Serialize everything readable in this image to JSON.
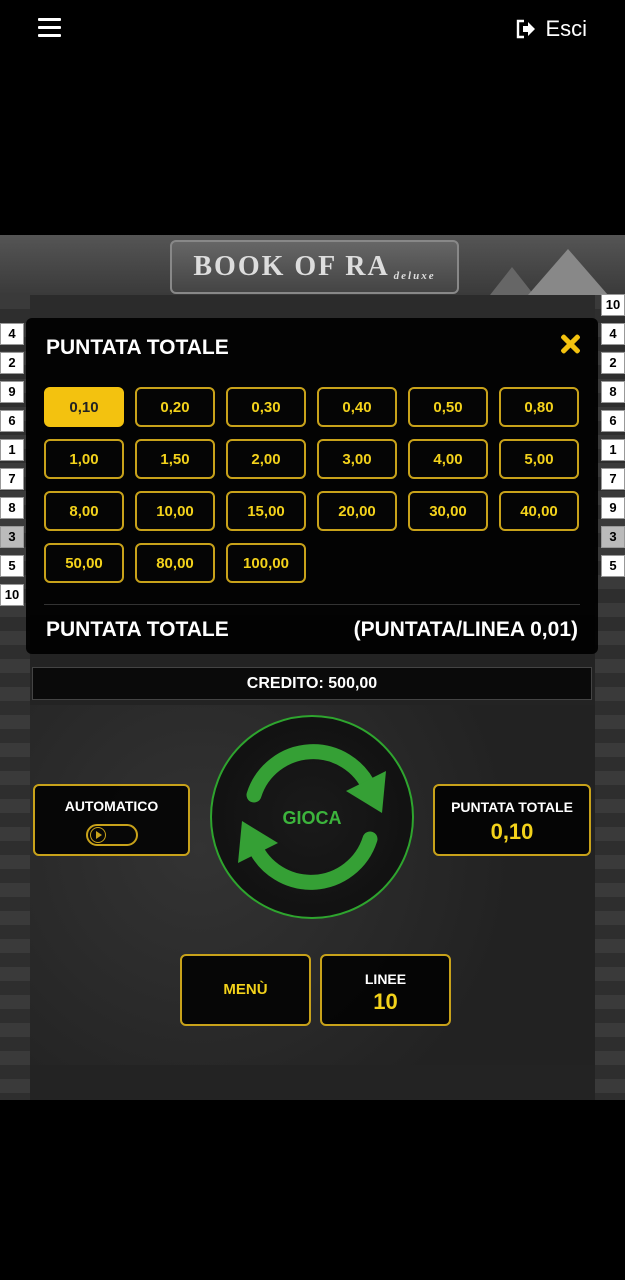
{
  "topbar": {
    "exit_label": "Esci"
  },
  "logo": {
    "main": "BOOK OF RA",
    "sub": "deluxe"
  },
  "line_numbers": {
    "left": [
      "4",
      "2",
      "9",
      "6",
      "1",
      "7",
      "8",
      "3",
      "5",
      "10"
    ],
    "right": [
      "10",
      "4",
      "2",
      "8",
      "6",
      "1",
      "7",
      "9",
      "3",
      "5"
    ]
  },
  "bet_panel": {
    "title": "PUNTATA TOTALE",
    "options": [
      "0,10",
      "0,20",
      "0,30",
      "0,40",
      "0,50",
      "0,80",
      "1,00",
      "1,50",
      "2,00",
      "3,00",
      "4,00",
      "5,00",
      "8,00",
      "10,00",
      "15,00",
      "20,00",
      "30,00",
      "40,00",
      "50,00",
      "80,00",
      "100,00"
    ],
    "selected": "0,10",
    "footer_left": "PUNTATA TOTALE",
    "footer_right": "(PUNTATA/LINEA 0,01)"
  },
  "credit": "CREDITO: 500,00",
  "controls": {
    "auto_label": "AUTOMATICO",
    "play_label": "GIOCA",
    "total_bet_label": "PUNTATA TOTALE",
    "total_bet_value": "0,10",
    "menu_label": "MENÙ",
    "lines_label": "LINEE",
    "lines_value": "10"
  },
  "colors": {
    "accent_gold": "#f3c20f",
    "play_green": "#3cb43c"
  }
}
